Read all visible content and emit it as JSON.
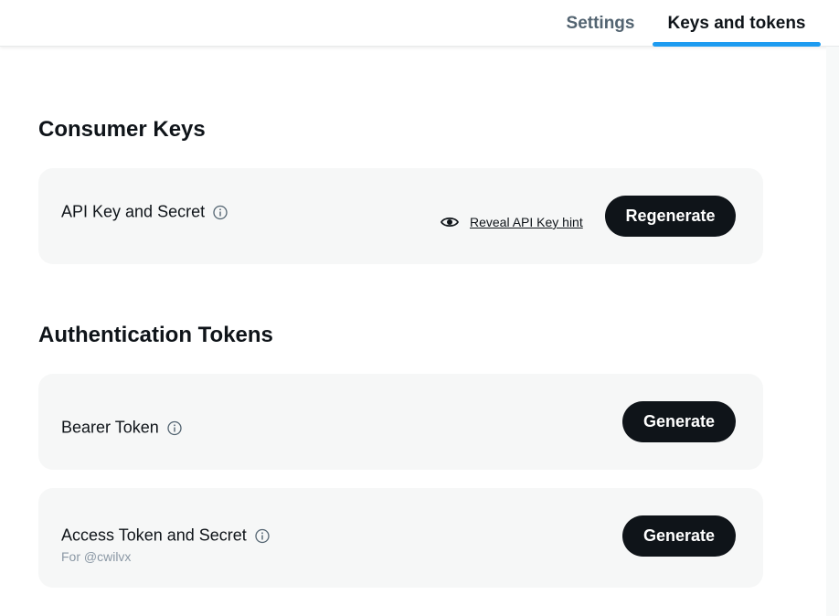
{
  "tabs": [
    {
      "label": "Settings",
      "active": false
    },
    {
      "label": "Keys and tokens",
      "active": true
    }
  ],
  "accent_color": "#1d9bf0",
  "consumer_keys": {
    "title": "Consumer Keys",
    "api_key": {
      "label": "API Key and Secret",
      "info_icon": "info-icon",
      "reveal_label": "Reveal API Key hint",
      "reveal_icon": "eye-icon",
      "button": "Regenerate"
    }
  },
  "auth_tokens": {
    "title": "Authentication Tokens",
    "bearer": {
      "label": "Bearer Token",
      "info_icon": "info-icon",
      "button": "Generate"
    },
    "access": {
      "label": "Access Token and Secret",
      "sub_label": "For @cwilvx",
      "info_icon": "info-icon",
      "button": "Generate"
    }
  }
}
